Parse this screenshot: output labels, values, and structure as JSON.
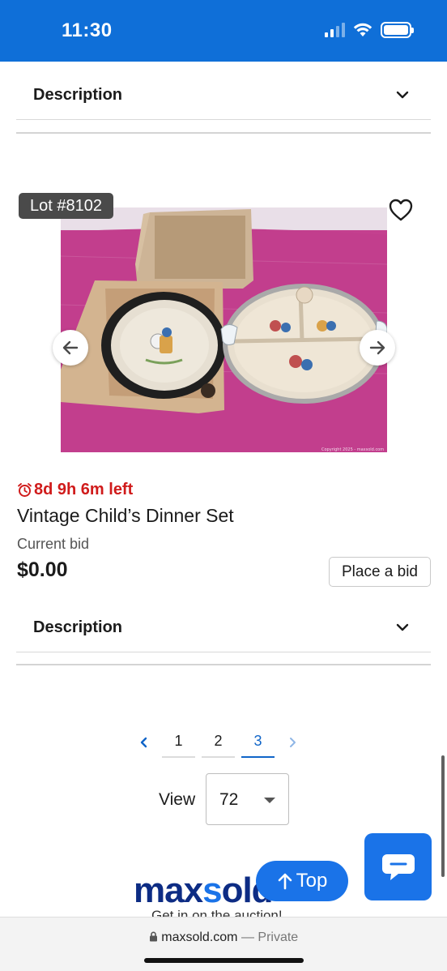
{
  "status_bar": {
    "time": "11:30"
  },
  "description_top": {
    "label": "Description"
  },
  "lot": {
    "badge": "Lot #8102",
    "time_left": "8d 9h 6m left",
    "title": "Vintage Child’s Dinner Set",
    "current_bid_label": "Current bid",
    "current_bid_value": "$0.00",
    "place_bid_label": "Place a bid",
    "photo_watermark": "Copyright 2025 - maxsold.com"
  },
  "description_bottom": {
    "label": "Description"
  },
  "pagination": {
    "pages": [
      "1",
      "2",
      "3"
    ],
    "active_page": "3"
  },
  "view": {
    "label": "View",
    "selected": "72"
  },
  "footer": {
    "logo_part1": "max",
    "logo_x": "s",
    "logo_part2": "old",
    "tagline": "Get in on the auction!",
    "top_button": "Top"
  },
  "browser": {
    "domain": "maxsold.com",
    "separator": " — ",
    "mode": "Private"
  },
  "colors": {
    "brand_blue": "#1a73e8",
    "status_bar": "#0f6fd8",
    "timer_red": "#d01b1b",
    "logo_navy": "#0d2c84"
  }
}
